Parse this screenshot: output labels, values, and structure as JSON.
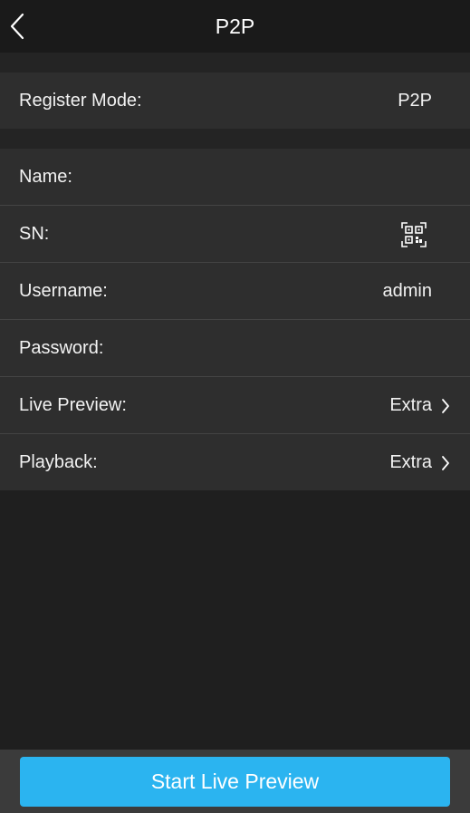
{
  "header": {
    "title": "P2P",
    "back_icon": "chevron-left-icon"
  },
  "register": {
    "label": "Register Mode:",
    "value": "P2P"
  },
  "fields": {
    "name": {
      "label": "Name:",
      "value": ""
    },
    "sn": {
      "label": "SN:",
      "value": "",
      "icon": "qr-code-scan-icon"
    },
    "username": {
      "label": "Username:",
      "value": "admin"
    },
    "password": {
      "label": "Password:",
      "value": ""
    },
    "live_preview": {
      "label": "Live Preview:",
      "value": "Extra",
      "icon": "chevron-right-icon"
    },
    "playback": {
      "label": "Playback:",
      "value": "Extra",
      "icon": "chevron-right-icon"
    }
  },
  "footer": {
    "start_button_label": "Start Live Preview"
  },
  "colors": {
    "accent": "#2bb4f0",
    "background": "#1f1f1f",
    "row_background": "#2e2e2e",
    "nav_background": "#1a1a1a"
  }
}
